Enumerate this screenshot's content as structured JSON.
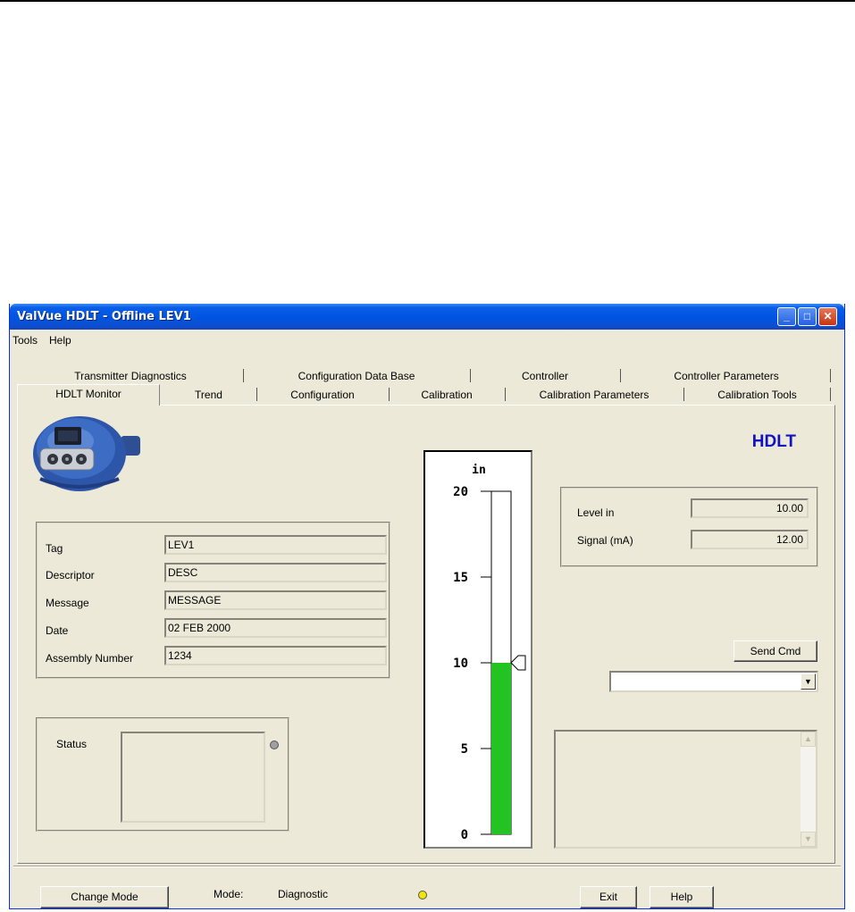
{
  "window": {
    "title": "ValVue HDLT - Offline  LEV1",
    "controls": {
      "minimize": "_",
      "maximize": "□",
      "close": "✕"
    }
  },
  "menu": [
    "Tools",
    "Help"
  ],
  "tabs": {
    "row1": [
      "Transmitter Diagnostics",
      "Configuration Data Base",
      "Controller",
      "Controller Parameters"
    ],
    "row2": [
      "HDLT Monitor",
      "Trend",
      "Configuration",
      "Calibration",
      "Calibration Parameters",
      "Calibration Tools"
    ],
    "active": "HDLT Monitor"
  },
  "device_image": {
    "icon": "transmitter-device-icon"
  },
  "brand_label": "HDLT",
  "info": {
    "tag_label": "Tag",
    "tag": "LEV1",
    "descriptor_label": "Descriptor",
    "descriptor": "DESC",
    "message_label": "Message",
    "message": "MESSAGE",
    "date_label": "Date",
    "date": "02 FEB 2000",
    "assembly_label": "Assembly Number",
    "assembly": "1234"
  },
  "status": {
    "label": "Status",
    "indicator_color": "#a0a0a0"
  },
  "gauge": {
    "unit": "in",
    "ticks": [
      "20",
      "15",
      "10",
      "5",
      "0"
    ],
    "max": 20,
    "level": 10,
    "fill_color": "#22c322"
  },
  "readings": {
    "level_label": "Level   in",
    "level": "10.00",
    "signal_label": "Signal (mA)",
    "signal": "12.00"
  },
  "send_cmd": "Send Cmd",
  "command_select": {
    "value": ""
  },
  "bottom": {
    "change_mode": "Change Mode",
    "mode_label": "Mode:",
    "mode_value": "Diagnostic",
    "mode_indicator_color": "#f0e800",
    "exit": "Exit",
    "help": "Help"
  }
}
